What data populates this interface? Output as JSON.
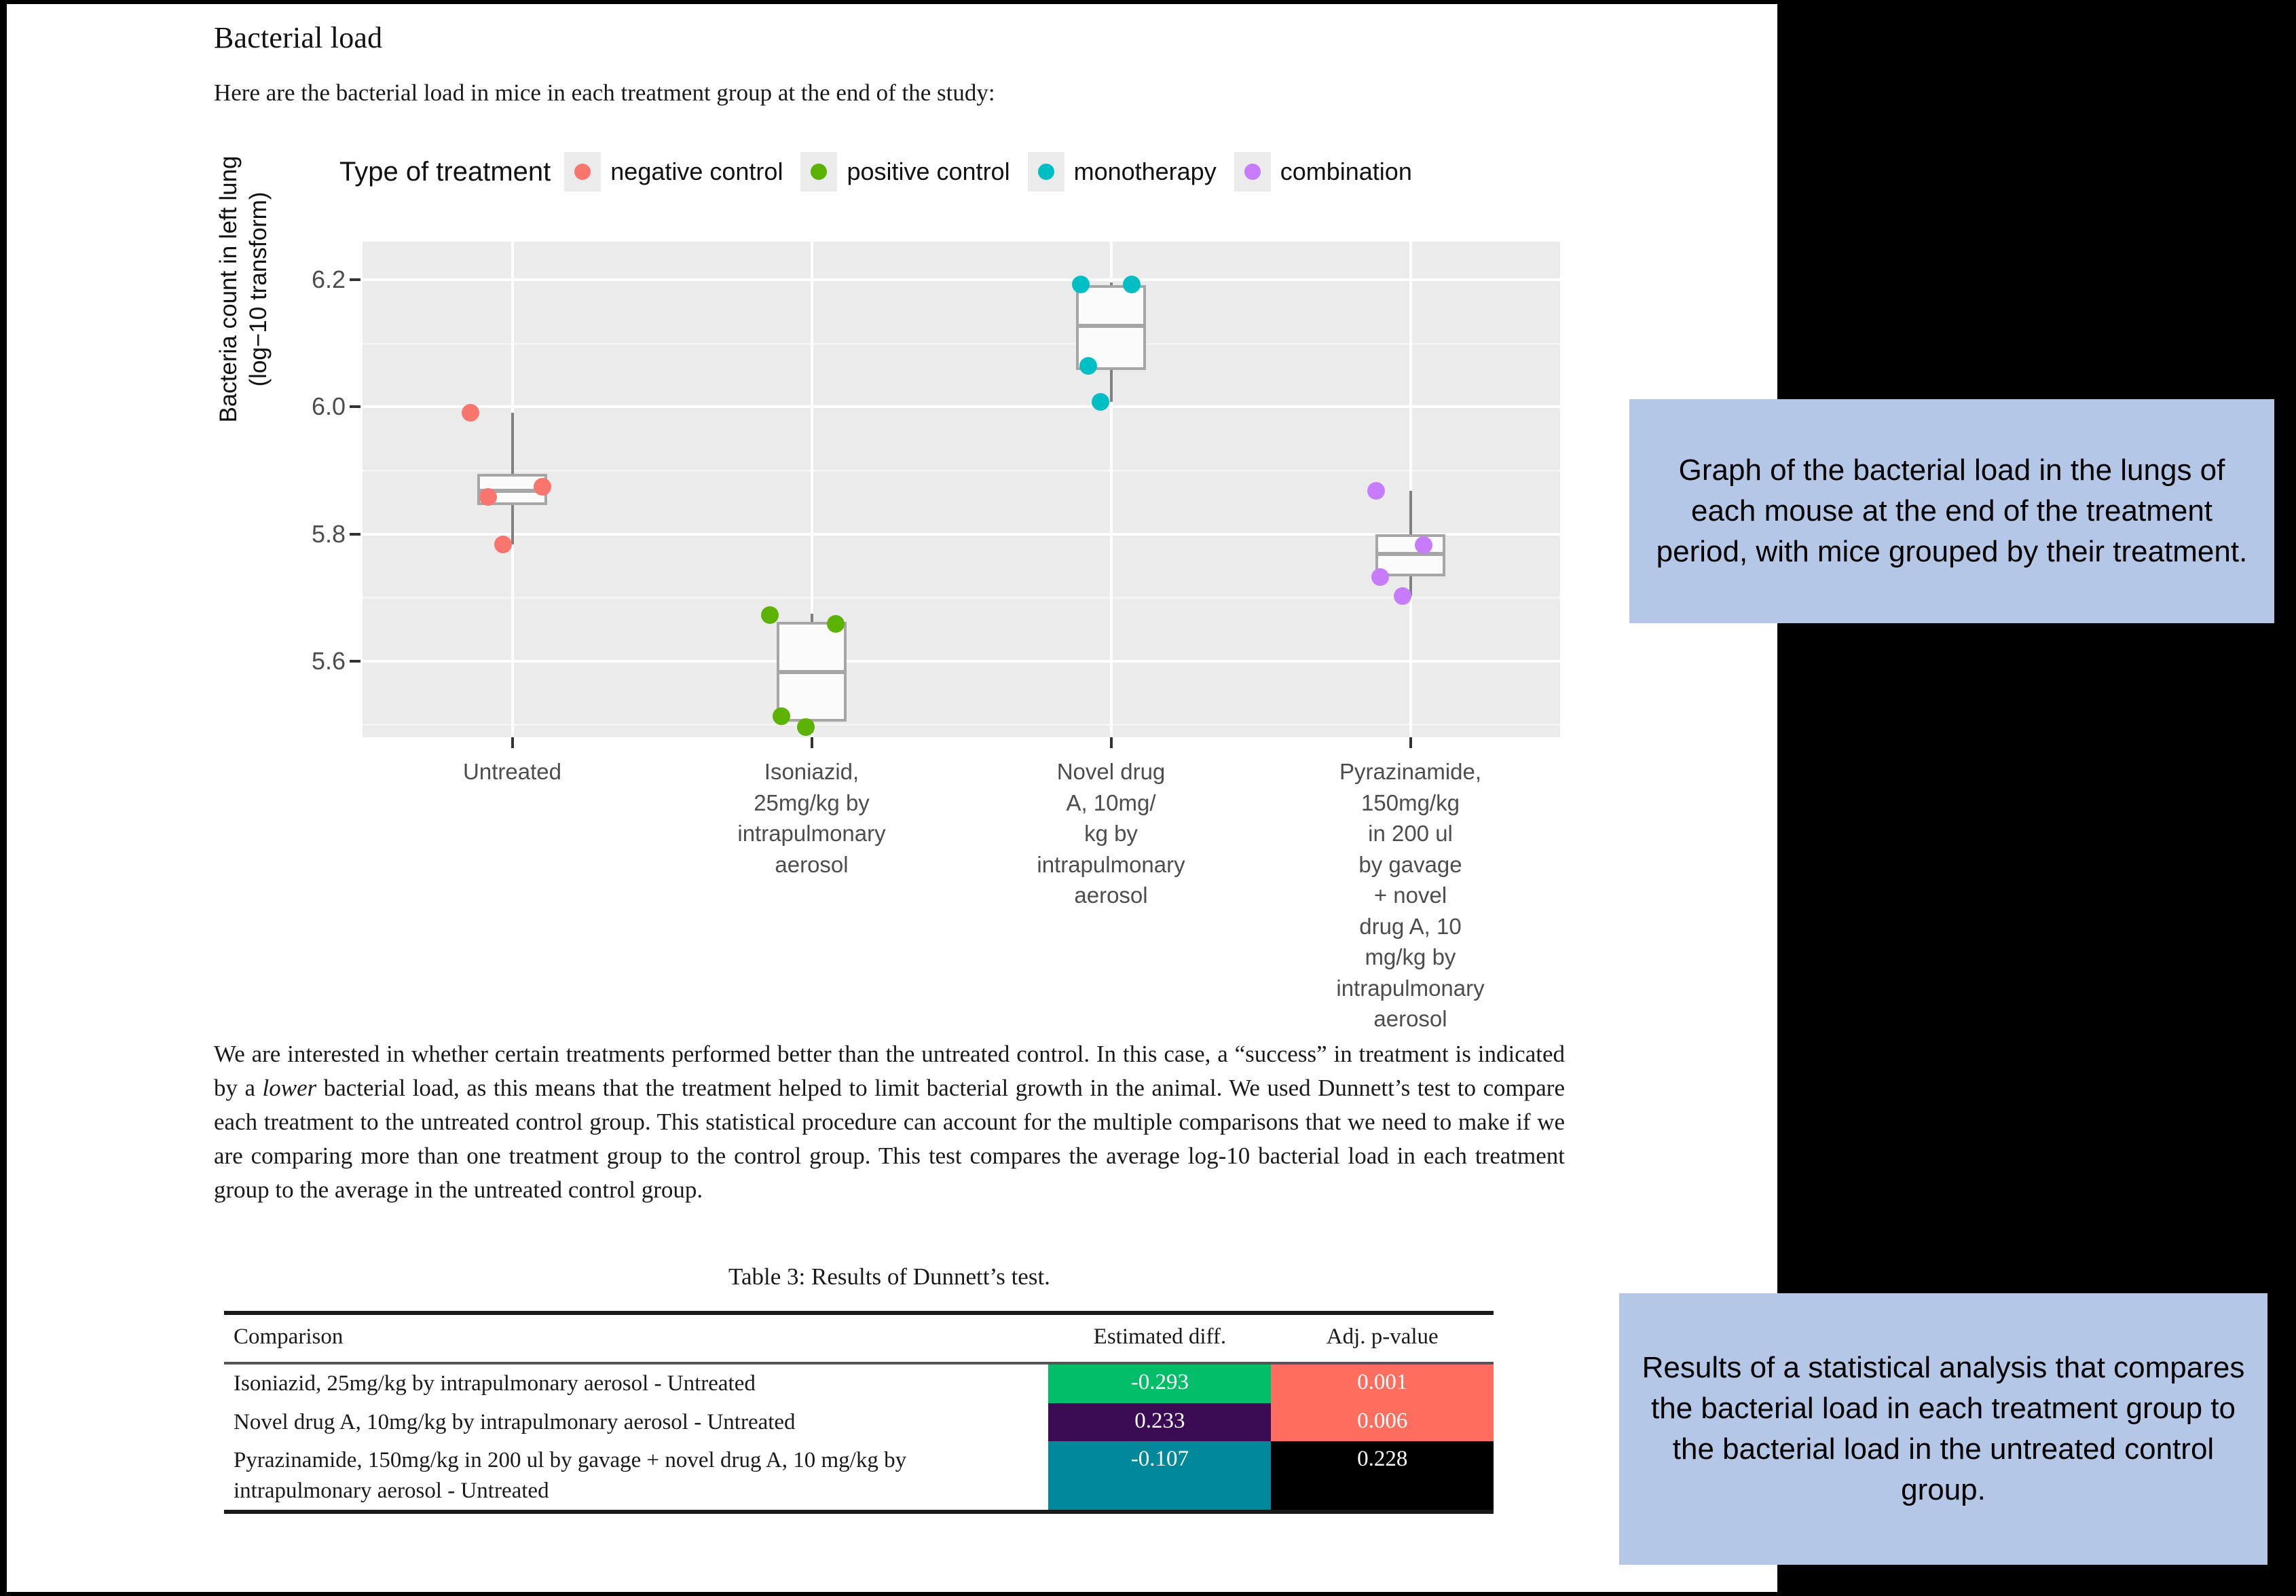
{
  "document": {
    "title": "Bacterial load",
    "intro": "Here are the bacterial load in mice in each treatment group at the end of the study:",
    "body_paragraph_part1": "We are interested in whether certain treatments performed better than the untreated control. In this case, a “success” in treatment is indicated by a ",
    "body_paragraph_emphasis": "lower",
    "body_paragraph_part2": " bacterial load, as this means that the treatment helped to limit bacterial growth in the animal. We used Dunnett’s test to compare each treatment to the untreated control group. This statistical procedure can account for the multiple comparisons that we need to make if we are comparing more than one treatment group to the control group. This test compares the average log-10 bacterial load in each treatment group to the average in the untreated control group."
  },
  "chart_data": {
    "type": "box",
    "title": "",
    "xlabel": "",
    "ylabel": "Bacteria count in left lung\n(log−10 transform)",
    "ylabel_line1": "Bacteria count in left lung",
    "ylabel_line2": "(log−10 transform)",
    "ylim": [
      5.48,
      6.26
    ],
    "yticks": [
      5.6,
      5.8,
      6.0,
      6.2
    ],
    "ytick_labels": [
      "5.6",
      "5.8",
      "6.0",
      "6.2"
    ],
    "grid": true,
    "legend_title": "Type of treatment",
    "legend_position": "top",
    "legend": [
      {
        "label": "negative control",
        "color": "#F8766D"
      },
      {
        "label": "positive control",
        "color": "#5CB200"
      },
      {
        "label": "monotherapy",
        "color": "#00BFC4"
      },
      {
        "label": "combination",
        "color": "#C77CFF"
      }
    ],
    "categories": [
      "Untreated",
      "Isoniazid, 25mg/kg by intrapulmonary aerosol",
      "Novel drug A, 10mg/kg by intrapulmonary aerosol",
      "Pyrazinamide, 150mg/kg in 200 ul by gavage + novel drug A, 10 mg/kg by intrapulmonary aerosol"
    ],
    "category_tick_lines": [
      [
        "Untreated"
      ],
      [
        "Isoniazid,",
        "25mg/kg by",
        "intrapulmonary",
        "aerosol"
      ],
      [
        "Novel drug",
        "A, 10mg/",
        "kg by",
        "intrapulmonary",
        "aerosol"
      ],
      [
        "Pyrazinamide,",
        "150mg/kg",
        "in 200 ul",
        "by gavage",
        "+ novel",
        "drug A, 10",
        "mg/kg by",
        "intrapulmonary",
        "aerosol"
      ]
    ],
    "groups": [
      {
        "name": "Untreated",
        "treatment_type": "negative control",
        "color": "#F8766D",
        "box": {
          "q1": 5.845,
          "median": 5.868,
          "q3": 5.895,
          "whisker_low": 5.783,
          "whisker_high": 5.991
        },
        "points": [
          {
            "value": 5.991,
            "jitter": -0.14
          },
          {
            "value": 5.874,
            "jitter": 0.1
          },
          {
            "value": 5.858,
            "jitter": -0.08
          },
          {
            "value": 5.783,
            "jitter": -0.03
          }
        ]
      },
      {
        "name": "Isoniazid, 25mg/kg by intrapulmonary aerosol",
        "treatment_type": "positive control",
        "color": "#5CB200",
        "box": {
          "q1": 5.505,
          "median": 5.583,
          "q3": 5.662,
          "whisker_low": 5.487,
          "whisker_high": 5.675
        },
        "points": [
          {
            "value": 5.672,
            "jitter": -0.14
          },
          {
            "value": 5.658,
            "jitter": 0.08
          },
          {
            "value": 5.513,
            "jitter": -0.1
          },
          {
            "value": 5.496,
            "jitter": -0.02
          }
        ]
      },
      {
        "name": "Novel drug A, 10mg/kg by intrapulmonary aerosol",
        "treatment_type": "monotherapy",
        "color": "#00BFC4",
        "box": {
          "q1": 6.058,
          "median": 6.128,
          "q3": 6.192,
          "whisker_low": 6.008,
          "whisker_high": 6.196
        },
        "points": [
          {
            "value": 6.193,
            "jitter": -0.1
          },
          {
            "value": 6.193,
            "jitter": 0.07
          },
          {
            "value": 6.065,
            "jitter": -0.075
          },
          {
            "value": 6.008,
            "jitter": -0.035
          }
        ]
      },
      {
        "name": "Pyrazinamide, 150mg/kg in 200 ul by gavage + novel drug A, 10 mg/kg by intrapulmonary aerosol",
        "treatment_type": "combination",
        "color": "#C77CFF",
        "box": {
          "q1": 5.733,
          "median": 5.768,
          "q3": 5.8,
          "whisker_low": 5.702,
          "whisker_high": 5.868
        },
        "points": [
          {
            "value": 5.868,
            "jitter": -0.115
          },
          {
            "value": 5.782,
            "jitter": 0.045
          },
          {
            "value": 5.732,
            "jitter": -0.1
          },
          {
            "value": 5.702,
            "jitter": -0.025
          }
        ]
      }
    ]
  },
  "table": {
    "caption": "Table 3: Results of Dunnett’s test.",
    "columns": [
      "Comparison",
      "Estimated diff.",
      "Adj. p-value"
    ],
    "rows": [
      {
        "comparison": "Isoniazid, 25mg/kg by intrapulmonary aerosol - Untreated",
        "estimated_diff": "-0.293",
        "estimated_diff_bg": "#00BE67",
        "p_value": "0.001",
        "p_value_bg": "#FF6D5E"
      },
      {
        "comparison": "Novel drug A, 10mg/kg by intrapulmonary aerosol - Untreated",
        "estimated_diff": "0.233",
        "estimated_diff_bg": "#3B0B54",
        "p_value": "0.006",
        "p_value_bg": "#FF6D5E"
      },
      {
        "comparison": "Pyrazinamide, 150mg/kg in 200 ul by gavage + novel drug A, 10 mg/kg by intrapulmonary aerosol - Untreated",
        "estimated_diff": "-0.107",
        "estimated_diff_bg": "#01899B",
        "p_value": "0.228",
        "p_value_bg": "#000000"
      }
    ]
  },
  "callouts": {
    "graph": "Graph of the bacterial load in the lungs of each mouse at the end of the treatment period, with mice grouped by their treatment.",
    "table": "Results of a statistical analysis that compares the bacterial load in each treatment group to the bacterial load in the untreated control group.",
    "background": "#b4c7e7"
  }
}
